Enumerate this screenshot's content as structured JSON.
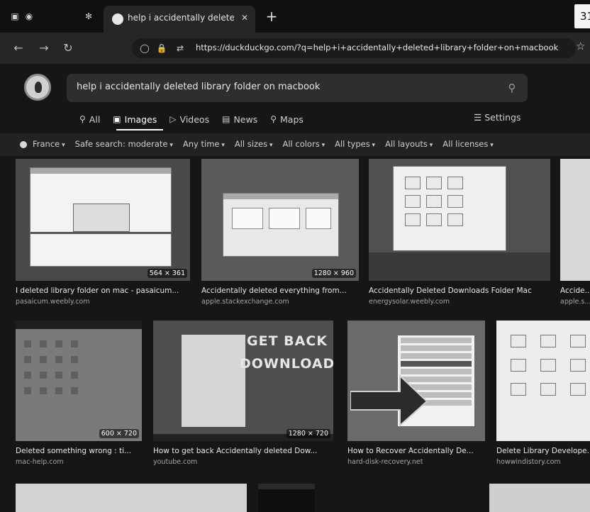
{
  "browser": {
    "tab_title": "help i accidentally deleted lib",
    "url": "https://duckduckgo.com/?q=help+i+accidentally+deleted+library+folder+on+macbook",
    "time_badge": "31"
  },
  "search": {
    "query": "help i accidentally deleted library folder on macbook"
  },
  "tabs": [
    {
      "label": "All",
      "icon": "search-icon"
    },
    {
      "label": "Images",
      "icon": "images-icon"
    },
    {
      "label": "Videos",
      "icon": "play-icon"
    },
    {
      "label": "News",
      "icon": "news-icon"
    },
    {
      "label": "Maps",
      "icon": "pin-icon"
    }
  ],
  "settings_label": "Settings",
  "filters": [
    "France",
    "Safe search: moderate",
    "Any time",
    "All sizes",
    "All colors",
    "All types",
    "All layouts",
    "All licenses"
  ],
  "results": [
    {
      "title": "I deleted library folder on mac - pasaicum...",
      "site": "pasaicum.weebly.com",
      "dims": "564 × 361"
    },
    {
      "title": "Accidentally deleted everything from...",
      "site": "apple.stackexchange.com",
      "dims": "1280 × 960"
    },
    {
      "title": "Accidentally Deleted Downloads Folder Mac",
      "site": "energysolar.weebly.com",
      "dims": ""
    },
    {
      "title": "Accide...",
      "site": "apple.s...",
      "dims": ""
    },
    {
      "title": "Deleted something wrong : ti...",
      "site": "mac-help.com",
      "dims": "600 × 720"
    },
    {
      "title": "How to get back Accidentally deleted Dow...",
      "site": "youtube.com",
      "dims": "1280 × 720"
    },
    {
      "title": "How to Recover Accidentally De...",
      "site": "hard-disk-recovery.net",
      "dims": ""
    },
    {
      "title": "Delete Library Develope...",
      "site": "howwindistory.com",
      "dims": ""
    }
  ],
  "thumb_text": {
    "get_back": "GET BACK",
    "download": "DOWNLOAD"
  }
}
